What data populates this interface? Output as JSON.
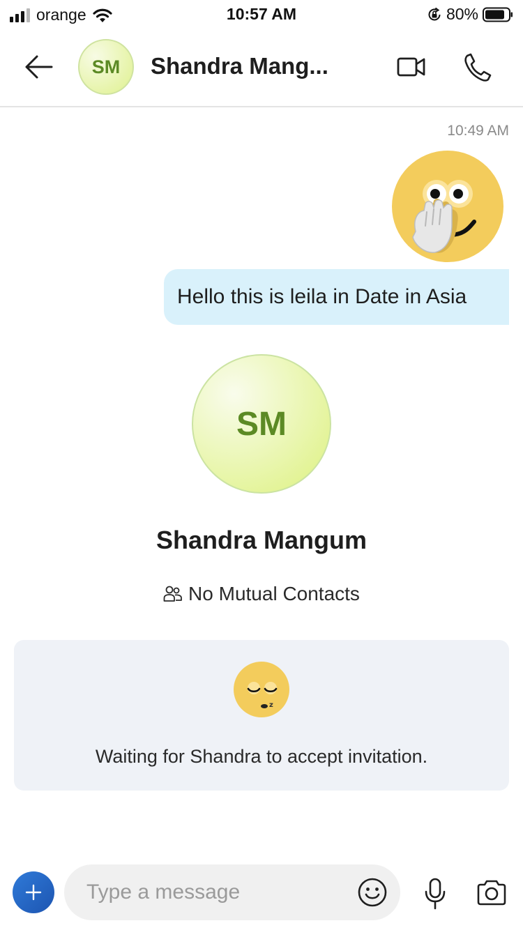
{
  "status_bar": {
    "carrier": "orange",
    "time": "10:57 AM",
    "battery_percent": "80%",
    "signal_bars": 3,
    "icons": [
      "signal-icon",
      "wifi-icon",
      "orientation-lock-icon",
      "battery-icon"
    ]
  },
  "header": {
    "avatar_initials": "SM",
    "contact_name": "Shandra Mang...",
    "icons": [
      "back-arrow-icon",
      "video-call-icon",
      "phone-call-icon"
    ]
  },
  "conversation": {
    "message_time": "10:49 AM",
    "sticker": "hand-over-mouth-emoji",
    "message_text": "Hello this is leila in Date in Asia"
  },
  "profile": {
    "avatar_initials": "SM",
    "name": "Shandra Mangum",
    "mutual_contacts": "No Mutual Contacts",
    "mutual_icon": "contacts-icon"
  },
  "invite": {
    "emoji": "sleeping-emoji",
    "text": "Waiting for Shandra to accept invitation."
  },
  "composer": {
    "placeholder": "Type a message",
    "icons": [
      "plus-icon",
      "emoji-icon",
      "microphone-icon",
      "camera-icon"
    ]
  },
  "colors": {
    "bubble": "#d9f1fb",
    "avatar_text": "#5c8a25",
    "avatar_fill": "#e1f38f",
    "accent_blue": "#1d55b1",
    "invite_card": "#eff2f7"
  }
}
